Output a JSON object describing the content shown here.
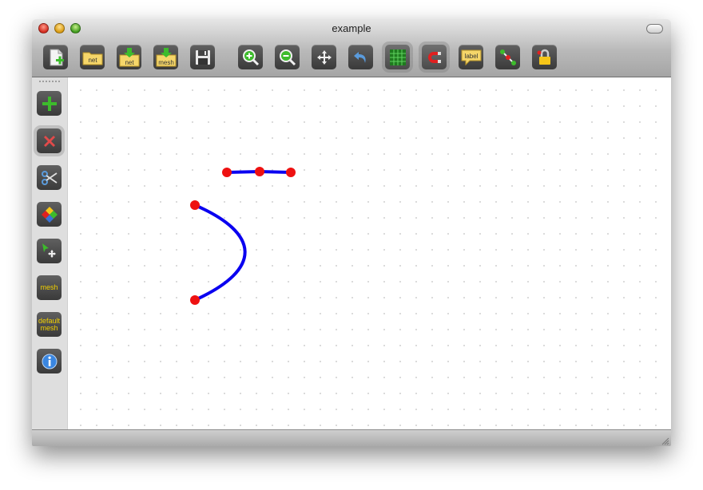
{
  "window": {
    "title": "example"
  },
  "toolbar": {
    "buttons": [
      {
        "name": "new-file-button",
        "icon": "new-document-icon",
        "label": ""
      },
      {
        "name": "open-net-button",
        "icon": "folder-icon",
        "label": "net"
      },
      {
        "name": "import-net-button",
        "icon": "import-icon",
        "label": "net"
      },
      {
        "name": "import-mesh-button",
        "icon": "import-icon",
        "label": "mesh"
      },
      {
        "name": "save-button",
        "icon": "floppy-disk-icon",
        "label": ""
      },
      {
        "name": "zoom-in-button",
        "icon": "zoom-in-icon",
        "label": ""
      },
      {
        "name": "zoom-out-button",
        "icon": "zoom-out-icon",
        "label": ""
      },
      {
        "name": "pan-button",
        "icon": "move-arrows-icon",
        "label": ""
      },
      {
        "name": "undo-button",
        "icon": "undo-arrow-icon",
        "label": ""
      },
      {
        "name": "grid-toggle-button",
        "icon": "grid-icon",
        "label": ""
      },
      {
        "name": "snap-magnet-button",
        "icon": "magnet-icon",
        "label": ""
      },
      {
        "name": "label-button",
        "icon": "speech-bubble-icon",
        "label": "label"
      },
      {
        "name": "show-nodes-button",
        "icon": "node-line-icon",
        "label": ""
      },
      {
        "name": "lock-button",
        "icon": "lock-icon",
        "label": ""
      }
    ]
  },
  "sidebar": {
    "tools": [
      {
        "name": "add-tool",
        "icon": "plus-icon",
        "label": ""
      },
      {
        "name": "delete-tool",
        "icon": "x-icon",
        "label": ""
      },
      {
        "name": "cut-tool",
        "icon": "scissors-icon",
        "label": ""
      },
      {
        "name": "color-tool",
        "icon": "diamond-palette-icon",
        "label": ""
      },
      {
        "name": "select-move-tool",
        "icon": "pointer-move-icon",
        "label": ""
      },
      {
        "name": "mesh-tool",
        "icon": "mesh-text-icon",
        "label": "mesh"
      },
      {
        "name": "default-mesh-tool",
        "icon": "default-mesh-text-icon",
        "label_line1": "default",
        "label_line2": "mesh"
      },
      {
        "name": "info-tool",
        "icon": "info-icon",
        "label": ""
      }
    ]
  },
  "colors": {
    "edge": "#0a00f0",
    "node": "#ee1111",
    "canvas": "#ffffff"
  }
}
